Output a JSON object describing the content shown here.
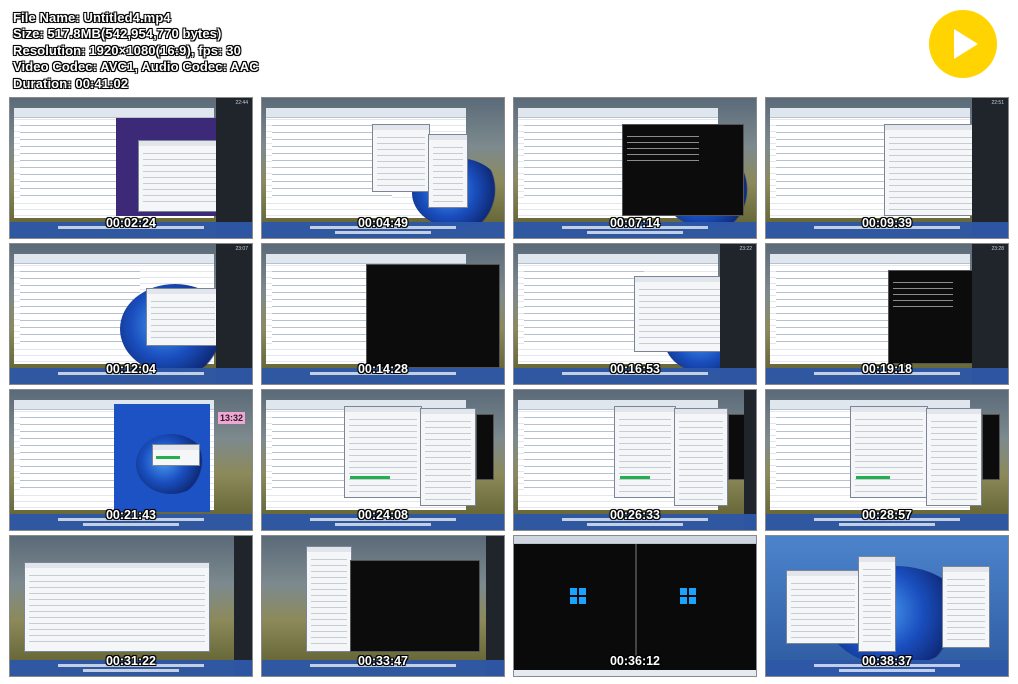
{
  "file_info": {
    "file_name": "File Name: Untitled4.mp4",
    "size": "Size: 517.8MB(542,954,770 bytes)",
    "resolution": "Resolution: 1920×1080(16:9), fps: 30",
    "codec": "Video Codec: AVC1, Audio Codec: AAC",
    "duration": "Duration: 00:41:02"
  },
  "play_button": {
    "icon": "play-icon",
    "color": "#ffd400"
  },
  "thumbnails": [
    {
      "timestamp": "00:02:24",
      "scene": "vm-purple-dialog"
    },
    {
      "timestamp": "00:04:49",
      "scene": "dialog-list"
    },
    {
      "timestamp": "00:07:14",
      "scene": "console"
    },
    {
      "timestamp": "00:09:39",
      "scene": "explorer"
    },
    {
      "timestamp": "00:12:04",
      "scene": "win11-dialog"
    },
    {
      "timestamp": "00:14:28",
      "scene": "black-panel"
    },
    {
      "timestamp": "00:16:53",
      "scene": "explorer-win11"
    },
    {
      "timestamp": "00:19:18",
      "scene": "console-large"
    },
    {
      "timestamp": "00:21:43",
      "scene": "blue-desktop-sticky",
      "sticky_text": "13:32"
    },
    {
      "timestamp": "00:24:08",
      "scene": "vm-settings"
    },
    {
      "timestamp": "00:26:33",
      "scene": "vm-settings"
    },
    {
      "timestamp": "00:28:57",
      "scene": "vm-settings"
    },
    {
      "timestamp": "00:31:22",
      "scene": "field-explorer"
    },
    {
      "timestamp": "00:33:47",
      "scene": "field-black"
    },
    {
      "timestamp": "00:36:12",
      "scene": "dual-boot"
    },
    {
      "timestamp": "00:38:37",
      "scene": "win11-settings"
    }
  ]
}
